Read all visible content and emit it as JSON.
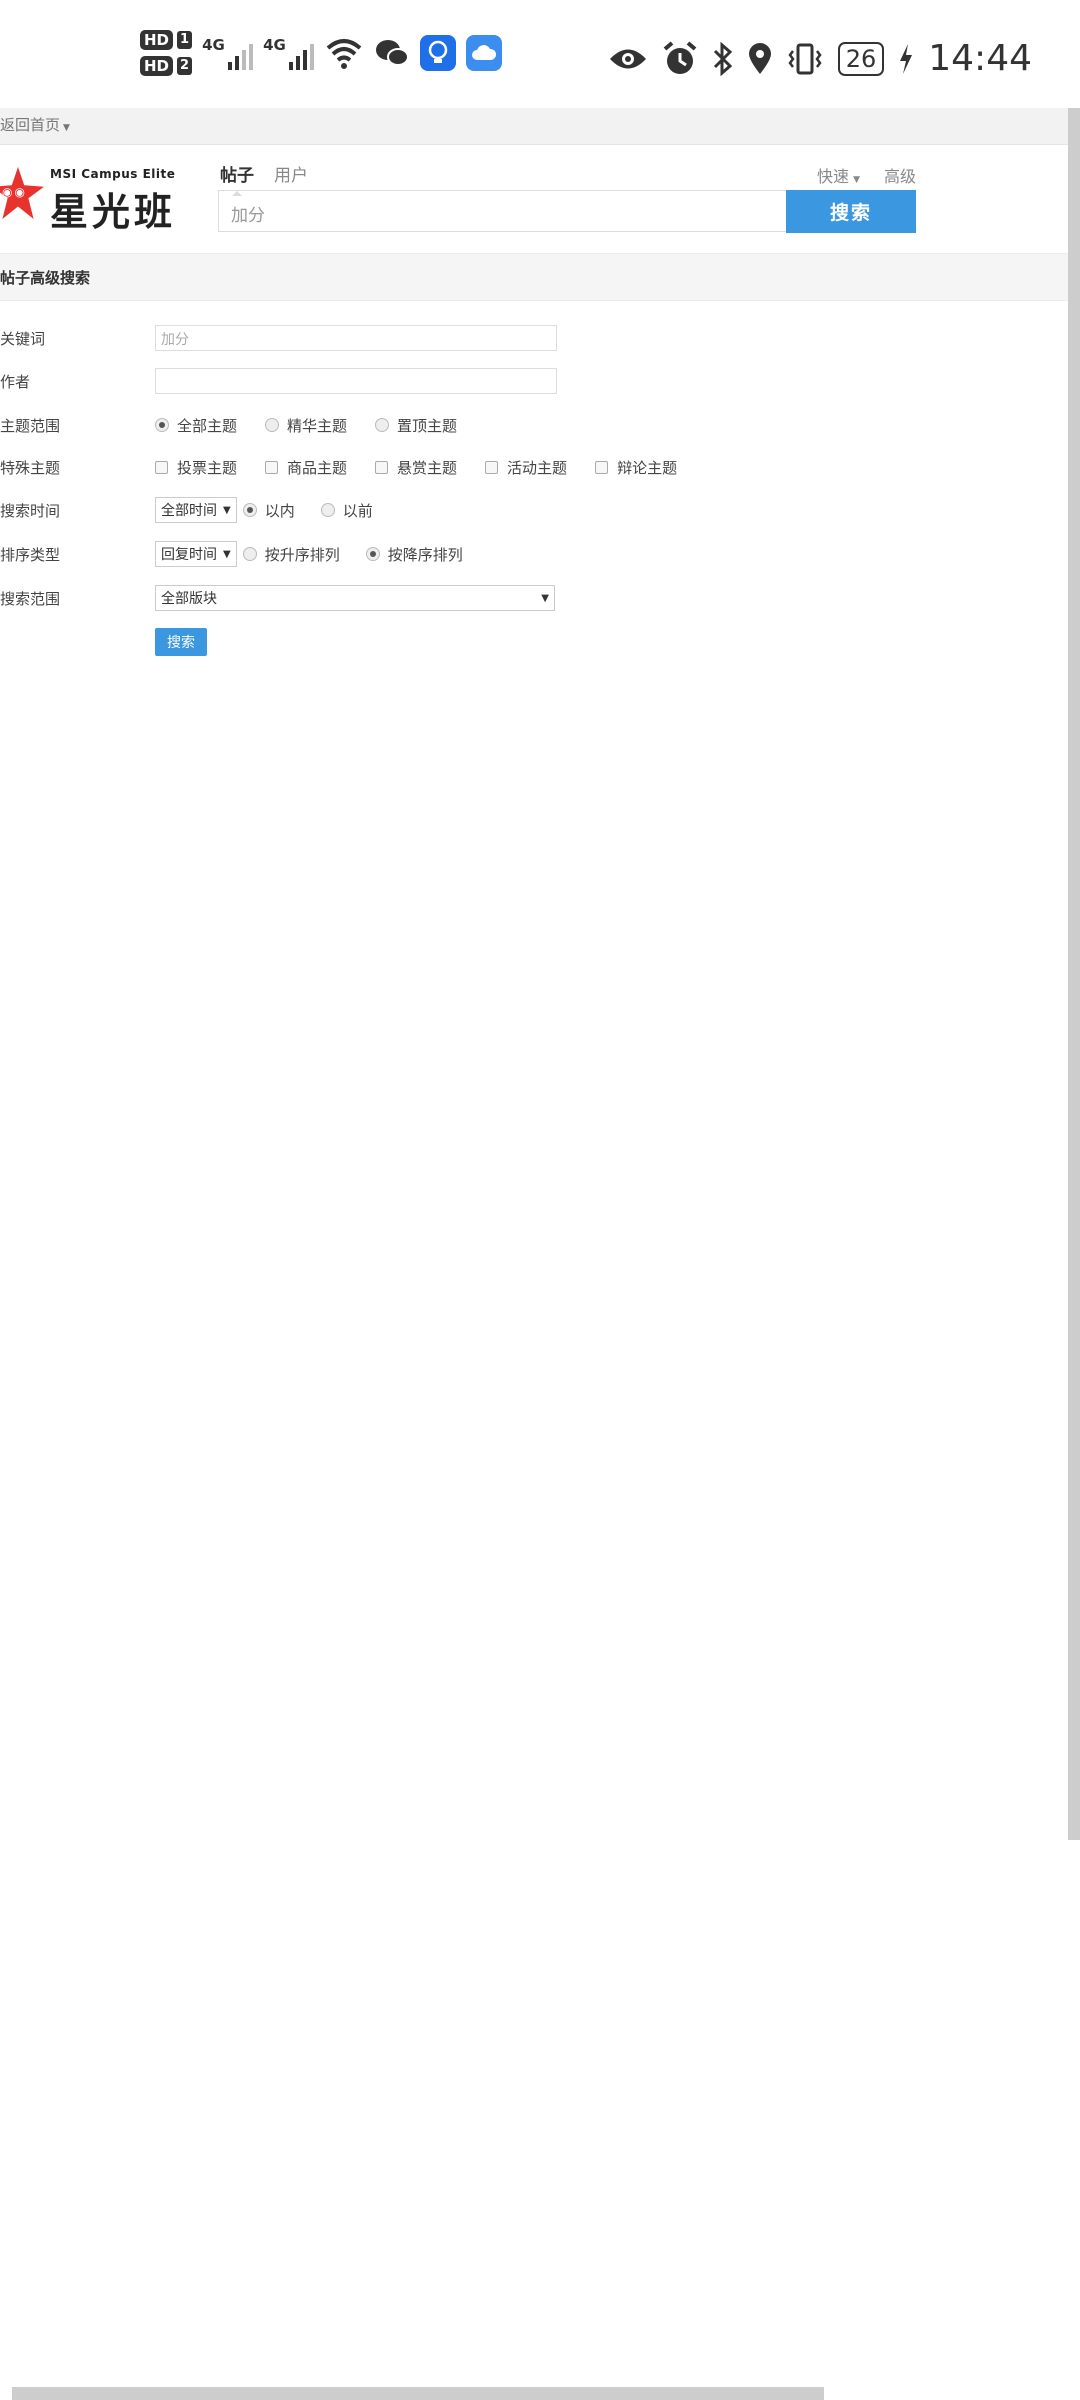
{
  "status_bar": {
    "sim1_hd": "HD",
    "sim1_num": "1",
    "sim2_hd": "HD",
    "sim2_num": "2",
    "network1": "4G",
    "network2": "4G",
    "battery": "26",
    "time": "14:44"
  },
  "page": {
    "back_home": "返回首页",
    "logo_en": "MSI Campus Elite",
    "logo_cn": "星光班",
    "tabs": [
      {
        "label": "帖子",
        "active": true
      },
      {
        "label": "用户",
        "active": false
      }
    ],
    "quick_label": "快速",
    "advanced_label": "高级",
    "search_value": "加分",
    "search_button": "搜索"
  },
  "section_title": "帖子高级搜索",
  "form": {
    "keyword_label": "关键词",
    "keyword_value": "加分",
    "author_label": "作者",
    "author_value": "",
    "scope_label": "主题范围",
    "scope_options": [
      {
        "label": "全部主题",
        "selected": true
      },
      {
        "label": "精华主题",
        "selected": false
      },
      {
        "label": "置顶主题",
        "selected": false
      }
    ],
    "special_label": "特殊主题",
    "special_options": [
      "投票主题",
      "商品主题",
      "悬赏主题",
      "活动主题",
      "辩论主题"
    ],
    "time_label": "搜索时间",
    "time_select": "全部时间",
    "time_options": [
      {
        "label": "以内",
        "selected": true
      },
      {
        "label": "以前",
        "selected": false
      }
    ],
    "sort_label": "排序类型",
    "sort_select": "回复时间",
    "sort_options": [
      {
        "label": "按升序排列",
        "selected": false
      },
      {
        "label": "按降序排列",
        "selected": true
      }
    ],
    "range_label": "搜索范围",
    "range_select": "全部版块",
    "submit": "搜索"
  }
}
